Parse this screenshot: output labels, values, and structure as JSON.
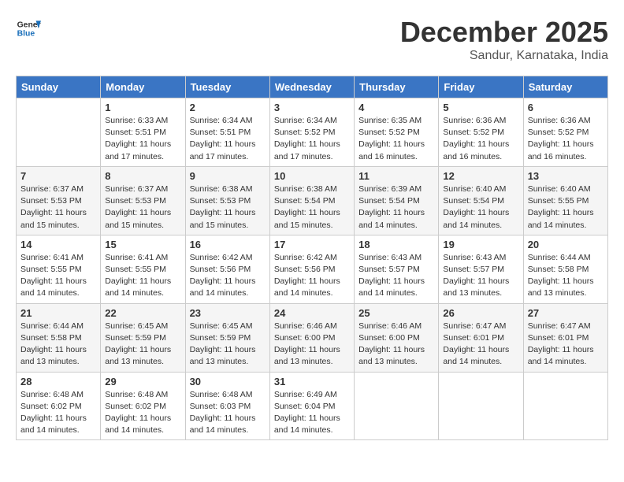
{
  "header": {
    "logo_line1": "General",
    "logo_line2": "Blue",
    "month": "December 2025",
    "location": "Sandur, Karnataka, India"
  },
  "weekdays": [
    "Sunday",
    "Monday",
    "Tuesday",
    "Wednesday",
    "Thursday",
    "Friday",
    "Saturday"
  ],
  "weeks": [
    [
      {
        "day": "",
        "sunrise": "",
        "sunset": "",
        "daylight": ""
      },
      {
        "day": "1",
        "sunrise": "6:33 AM",
        "sunset": "5:51 PM",
        "daylight": "11 hours and 17 minutes."
      },
      {
        "day": "2",
        "sunrise": "6:34 AM",
        "sunset": "5:51 PM",
        "daylight": "11 hours and 17 minutes."
      },
      {
        "day": "3",
        "sunrise": "6:34 AM",
        "sunset": "5:52 PM",
        "daylight": "11 hours and 17 minutes."
      },
      {
        "day": "4",
        "sunrise": "6:35 AM",
        "sunset": "5:52 PM",
        "daylight": "11 hours and 16 minutes."
      },
      {
        "day": "5",
        "sunrise": "6:36 AM",
        "sunset": "5:52 PM",
        "daylight": "11 hours and 16 minutes."
      },
      {
        "day": "6",
        "sunrise": "6:36 AM",
        "sunset": "5:52 PM",
        "daylight": "11 hours and 16 minutes."
      }
    ],
    [
      {
        "day": "7",
        "sunrise": "6:37 AM",
        "sunset": "5:53 PM",
        "daylight": "11 hours and 15 minutes."
      },
      {
        "day": "8",
        "sunrise": "6:37 AM",
        "sunset": "5:53 PM",
        "daylight": "11 hours and 15 minutes."
      },
      {
        "day": "9",
        "sunrise": "6:38 AM",
        "sunset": "5:53 PM",
        "daylight": "11 hours and 15 minutes."
      },
      {
        "day": "10",
        "sunrise": "6:38 AM",
        "sunset": "5:54 PM",
        "daylight": "11 hours and 15 minutes."
      },
      {
        "day": "11",
        "sunrise": "6:39 AM",
        "sunset": "5:54 PM",
        "daylight": "11 hours and 14 minutes."
      },
      {
        "day": "12",
        "sunrise": "6:40 AM",
        "sunset": "5:54 PM",
        "daylight": "11 hours and 14 minutes."
      },
      {
        "day": "13",
        "sunrise": "6:40 AM",
        "sunset": "5:55 PM",
        "daylight": "11 hours and 14 minutes."
      }
    ],
    [
      {
        "day": "14",
        "sunrise": "6:41 AM",
        "sunset": "5:55 PM",
        "daylight": "11 hours and 14 minutes."
      },
      {
        "day": "15",
        "sunrise": "6:41 AM",
        "sunset": "5:55 PM",
        "daylight": "11 hours and 14 minutes."
      },
      {
        "day": "16",
        "sunrise": "6:42 AM",
        "sunset": "5:56 PM",
        "daylight": "11 hours and 14 minutes."
      },
      {
        "day": "17",
        "sunrise": "6:42 AM",
        "sunset": "5:56 PM",
        "daylight": "11 hours and 14 minutes."
      },
      {
        "day": "18",
        "sunrise": "6:43 AM",
        "sunset": "5:57 PM",
        "daylight": "11 hours and 14 minutes."
      },
      {
        "day": "19",
        "sunrise": "6:43 AM",
        "sunset": "5:57 PM",
        "daylight": "11 hours and 13 minutes."
      },
      {
        "day": "20",
        "sunrise": "6:44 AM",
        "sunset": "5:58 PM",
        "daylight": "11 hours and 13 minutes."
      }
    ],
    [
      {
        "day": "21",
        "sunrise": "6:44 AM",
        "sunset": "5:58 PM",
        "daylight": "11 hours and 13 minutes."
      },
      {
        "day": "22",
        "sunrise": "6:45 AM",
        "sunset": "5:59 PM",
        "daylight": "11 hours and 13 minutes."
      },
      {
        "day": "23",
        "sunrise": "6:45 AM",
        "sunset": "5:59 PM",
        "daylight": "11 hours and 13 minutes."
      },
      {
        "day": "24",
        "sunrise": "6:46 AM",
        "sunset": "6:00 PM",
        "daylight": "11 hours and 13 minutes."
      },
      {
        "day": "25",
        "sunrise": "6:46 AM",
        "sunset": "6:00 PM",
        "daylight": "11 hours and 13 minutes."
      },
      {
        "day": "26",
        "sunrise": "6:47 AM",
        "sunset": "6:01 PM",
        "daylight": "11 hours and 14 minutes."
      },
      {
        "day": "27",
        "sunrise": "6:47 AM",
        "sunset": "6:01 PM",
        "daylight": "11 hours and 14 minutes."
      }
    ],
    [
      {
        "day": "28",
        "sunrise": "6:48 AM",
        "sunset": "6:02 PM",
        "daylight": "11 hours and 14 minutes."
      },
      {
        "day": "29",
        "sunrise": "6:48 AM",
        "sunset": "6:02 PM",
        "daylight": "11 hours and 14 minutes."
      },
      {
        "day": "30",
        "sunrise": "6:48 AM",
        "sunset": "6:03 PM",
        "daylight": "11 hours and 14 minutes."
      },
      {
        "day": "31",
        "sunrise": "6:49 AM",
        "sunset": "6:04 PM",
        "daylight": "11 hours and 14 minutes."
      },
      {
        "day": "",
        "sunrise": "",
        "sunset": "",
        "daylight": ""
      },
      {
        "day": "",
        "sunrise": "",
        "sunset": "",
        "daylight": ""
      },
      {
        "day": "",
        "sunrise": "",
        "sunset": "",
        "daylight": ""
      }
    ]
  ]
}
